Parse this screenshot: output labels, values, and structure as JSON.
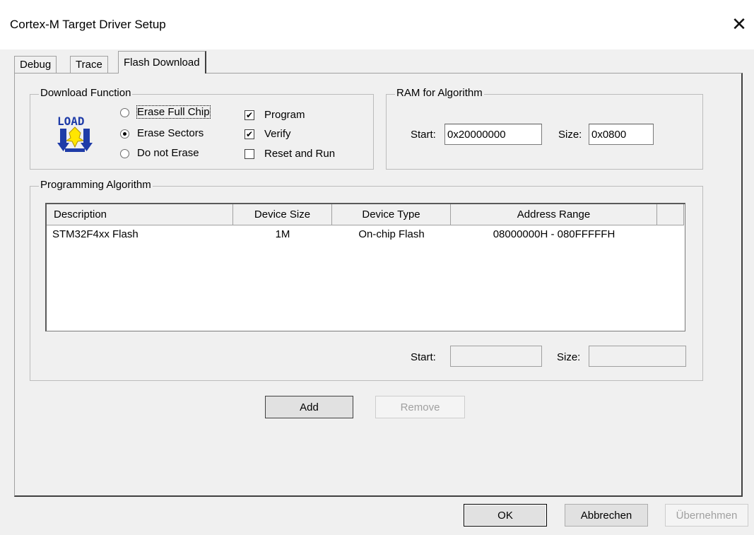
{
  "window": {
    "title": "Cortex-M Target Driver Setup",
    "close_glyph": "✕"
  },
  "tabs": [
    {
      "label": "Debug",
      "active": false
    },
    {
      "label": "Trace",
      "active": false
    },
    {
      "label": "Flash Download",
      "active": true
    }
  ],
  "download_function": {
    "legend": "Download Function",
    "icon_label": "LOAD",
    "erase_options": [
      {
        "label": "Erase Full Chip",
        "selected": false
      },
      {
        "label": "Erase Sectors",
        "selected": true
      },
      {
        "label": "Do not Erase",
        "selected": false
      }
    ],
    "checks": [
      {
        "label": "Program",
        "checked": true
      },
      {
        "label": "Verify",
        "checked": true
      },
      {
        "label": "Reset and Run",
        "checked": false
      }
    ]
  },
  "ram_for_algorithm": {
    "legend": "RAM for Algorithm",
    "start_label": "Start:",
    "start_value": "0x20000000",
    "size_label": "Size:",
    "size_value": "0x0800"
  },
  "programming_algorithm": {
    "legend": "Programming Algorithm",
    "columns": [
      "Description",
      "Device Size",
      "Device Type",
      "Address Range"
    ],
    "rows": [
      {
        "description": "STM32F4xx Flash",
        "device_size": "1M",
        "device_type": "On-chip Flash",
        "address_range": "08000000H - 080FFFFFH"
      }
    ],
    "start_label": "Start:",
    "start_value": "",
    "size_label": "Size:",
    "size_value": ""
  },
  "buttons": {
    "add": "Add",
    "remove": "Remove",
    "ok": "OK",
    "cancel": "Abbrechen",
    "apply": "Übernehmen"
  },
  "colors": {
    "dialog_bg": "#f0f0f0",
    "icon_blue": "#1f3ca8",
    "icon_yellow": "#ffe600"
  }
}
